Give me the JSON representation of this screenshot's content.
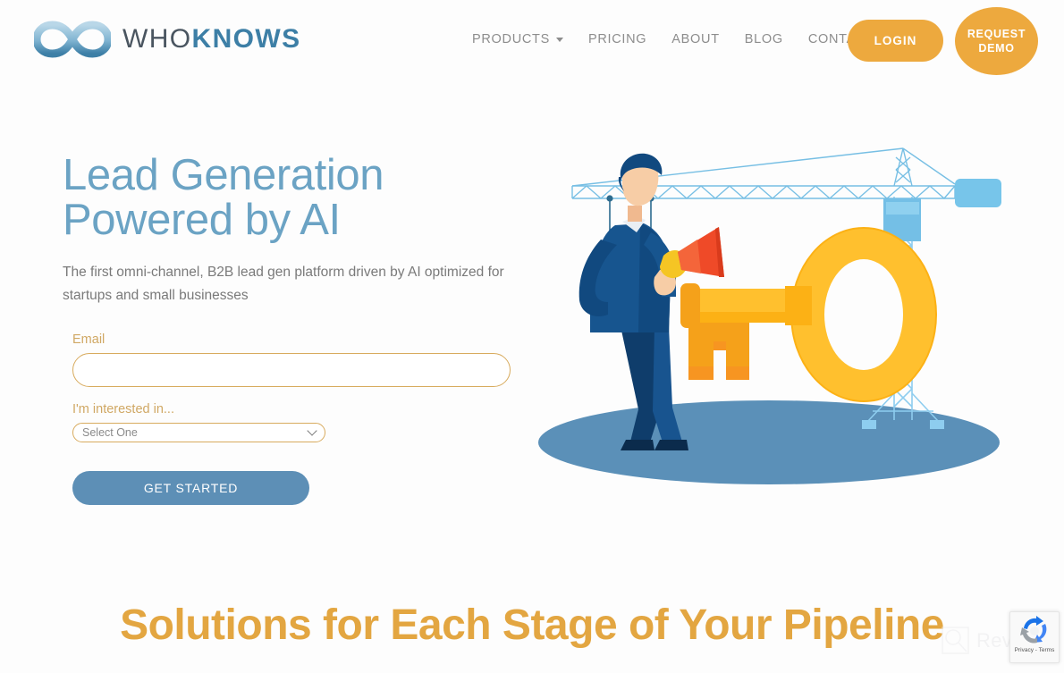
{
  "brand": {
    "mark_icon": "infinity-icon",
    "name_light": "WHO",
    "name_bold": "KNOWS"
  },
  "nav": {
    "items": [
      {
        "label": "PRODUCTS",
        "has_dropdown": true,
        "icon": "chevron-down-icon"
      },
      {
        "label": "PRICING",
        "has_dropdown": false
      },
      {
        "label": "ABOUT",
        "has_dropdown": false
      },
      {
        "label": "BLOG",
        "has_dropdown": false
      },
      {
        "label": "CONTACT",
        "has_dropdown": false
      }
    ],
    "login_label": "LOGIN",
    "demo_label_line1": "REQUEST",
    "demo_label_line2": "DEMO"
  },
  "hero": {
    "title_line1": "Lead Generation",
    "title_line2": "Powered by AI",
    "subtitle": "The first omni-channel, B2B lead gen platform driven by AI optimized for startups and small businesses",
    "illustration": "businessman-with-megaphone-and-crane-lifting-key-illustration"
  },
  "form": {
    "email_label": "Email",
    "email_value": "",
    "email_placeholder": "",
    "interest_label": "I'm interested in...",
    "interest_selected": "Select One",
    "interest_options": [
      "Select One"
    ],
    "submit_label": "GET STARTED"
  },
  "section": {
    "heading": "Solutions for Each Stage of Your Pipeline"
  },
  "recaptcha": {
    "privacy_terms": "Privacy - Terms",
    "icon": "recaptcha-arrows-icon"
  },
  "watermark": {
    "text": "Revain",
    "icon": "magnifier-square-icon"
  },
  "colors": {
    "accent_orange": "#eda93e",
    "heading_orange": "#e3a641",
    "brand_blue": "#3d7fa6",
    "hero_blue": "#6ba3c4",
    "button_blue": "#5d8fb6",
    "field_border": "#d8ab5e",
    "nav_gray": "#8d8d8d",
    "background": "#fdfdfd"
  }
}
